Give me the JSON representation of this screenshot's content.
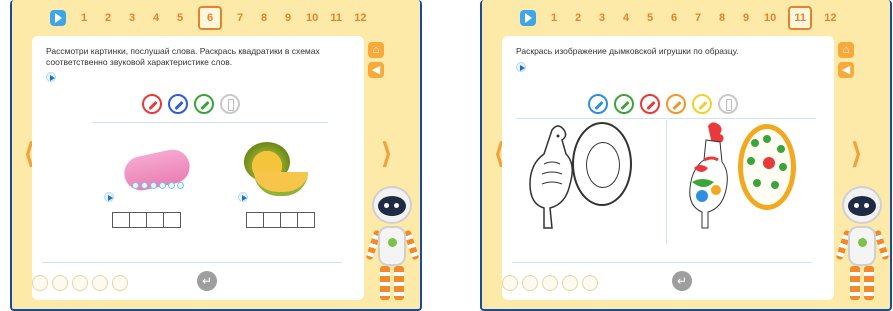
{
  "pages": [
    "1",
    "2",
    "3",
    "4",
    "5",
    "6",
    "7",
    "8",
    "9",
    "10",
    "11",
    "12"
  ],
  "left": {
    "active_page": "6",
    "instruction": "Рассмотри картинки, послушай слова. Раскрась квадратики в схемах соответственно звуковой характеристике слов.",
    "palette": [
      "red-pencil",
      "blue-pencil",
      "green-pencil",
      "eraser"
    ],
    "colors": {
      "red": "#e83a3a",
      "blue": "#2f5ce0",
      "green": "#3aa63a"
    },
    "words": [
      {
        "picture": "soap",
        "boxes": 4
      },
      {
        "picture": "melon",
        "boxes": 4
      }
    ]
  },
  "right": {
    "active_page": "11",
    "instruction": "Раскрась изображение дымковской игрушки по образцу.",
    "palette": [
      "blue-pencil",
      "green-pencil",
      "red-pencil",
      "orange-pencil",
      "yellow-pencil",
      "eraser"
    ],
    "colors": {
      "blue": "#2f8ee0",
      "green": "#3aa63a",
      "red": "#e83a3a",
      "orange": "#f2962a",
      "yellow": "#f2d22a"
    }
  },
  "progress_dots": 5,
  "icons": {
    "play": "play-icon",
    "home": "home-icon",
    "back": "back-arrow-icon",
    "enter": "enter-icon",
    "prev": "chevron-left-icon",
    "next": "chevron-right-icon",
    "mascot": "robot-mascot"
  },
  "glyphs": {
    "prev": "⟨",
    "next": "⟩",
    "enter": "↵",
    "home": "⌂",
    "back": "◀"
  }
}
